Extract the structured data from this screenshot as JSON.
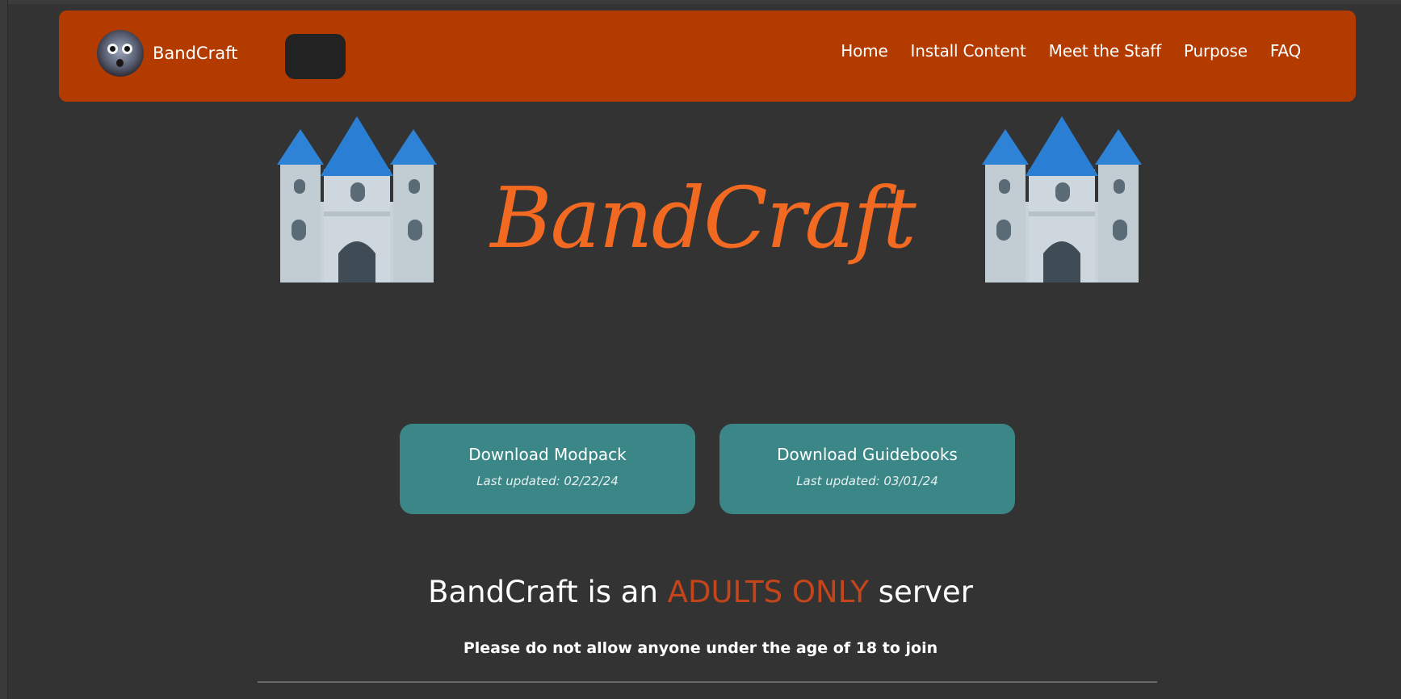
{
  "colors": {
    "navbar": "#b33b00",
    "background": "#333333",
    "button": "#3b8686",
    "accent": "#c5451a",
    "logo": "#f26a21"
  },
  "header": {
    "brand_name": "BandCraft",
    "avatar_icon": "raccoon-avatar-icon",
    "nav": [
      "Home",
      "Install Content",
      "Meet the Staff",
      "Purpose",
      "FAQ"
    ]
  },
  "hero": {
    "logo_text": "BandCraft",
    "castle_icon": "castle-icon"
  },
  "downloads": {
    "modpack": {
      "label": "Download Modpack",
      "updated": "Last updated: 02/22/24"
    },
    "guidebooks": {
      "label": "Download Guidebooks",
      "updated": "Last updated: 03/01/24"
    }
  },
  "notice": {
    "heading_prefix": "BandCraft is an ",
    "heading_accent": "ADULTS ONLY",
    "heading_suffix": " server",
    "subtext": "Please do not allow anyone under the age of 18 to join"
  }
}
